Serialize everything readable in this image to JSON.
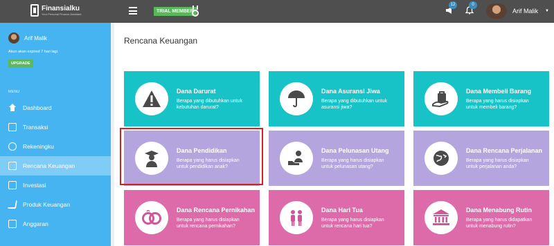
{
  "header": {
    "logo_name": "Finansialku",
    "logo_tagline": "Your Personal Finance Assistant",
    "trial_label": "TRIAL MEMBER",
    "announcements_count": "12",
    "notifications_count": "0",
    "user_name": "Arif Malik"
  },
  "sidebar": {
    "user_name": "Arif Malik",
    "expire_text": "Akun akan expired 7 hari lagi.",
    "upgrade_label": "UPGRADE",
    "menu_label": "MENU",
    "items": [
      {
        "label": "Dashboard",
        "icon": "home-icon",
        "active": false
      },
      {
        "label": "Transaksi",
        "icon": "document-icon",
        "active": false
      },
      {
        "label": "Rekeningku",
        "icon": "layers-icon",
        "active": false
      },
      {
        "label": "Rencana Keuangan",
        "icon": "clipboard-icon",
        "active": true
      },
      {
        "label": "Investasi",
        "icon": "chart-icon",
        "active": false
      },
      {
        "label": "Produk Keuangan",
        "icon": "cart-icon",
        "active": false
      },
      {
        "label": "Anggaran",
        "icon": "budget-icon",
        "active": false
      }
    ]
  },
  "page": {
    "title": "Rencana Keuangan"
  },
  "cards": [
    {
      "title": "Dana Darurat",
      "desc": "Berapa yang dibutuhkan untuk kebutuhan darurat?",
      "color": "#17c3c6",
      "icon": "warning-icon"
    },
    {
      "title": "Dana Asuransi Jiwa",
      "desc": "Berapa yang dibutuhkan untuk asuransi jiwa?",
      "color": "#17c3c6",
      "icon": "umbrella-icon"
    },
    {
      "title": "Dana Membeli Barang",
      "desc": "Berapa yang harus disiapkan untuk membeli barang?",
      "color": "#17c3c6",
      "icon": "shopping-bag-icon"
    },
    {
      "title": "Dana Pendidikan",
      "desc": "Berapa yang harus disiapkan untuk pendidikan anak?",
      "color": "#b4a5de",
      "icon": "graduate-icon"
    },
    {
      "title": "Dana Pelunasan Utang",
      "desc": "Berapa yang harus disiapkan untuk pelunasan utang?",
      "color": "#b4a5de",
      "icon": "debt-icon"
    },
    {
      "title": "Dana Rencana Perjalanan",
      "desc": "Berapa yang harus disiapkan untuk perjalanan anda?",
      "color": "#b4a5de",
      "icon": "globe-plane-icon"
    },
    {
      "title": "Dana Rencana Pernikahan",
      "desc": "Berapa yang harus disiapkan untuk rencana pernikahan?",
      "color": "#de6ba9",
      "icon": "rings-icon"
    },
    {
      "title": "Dana Hari Tua",
      "desc": "Berapa yang harus disiapkan untuk rencana hari tua?",
      "color": "#de6ba9",
      "icon": "elderly-couple-icon"
    },
    {
      "title": "Dana Menabung Rutin",
      "desc": "Berapa yang harus didapatkan untuk menabung rutin?",
      "color": "#de6ba9",
      "icon": "bank-icon"
    }
  ]
}
